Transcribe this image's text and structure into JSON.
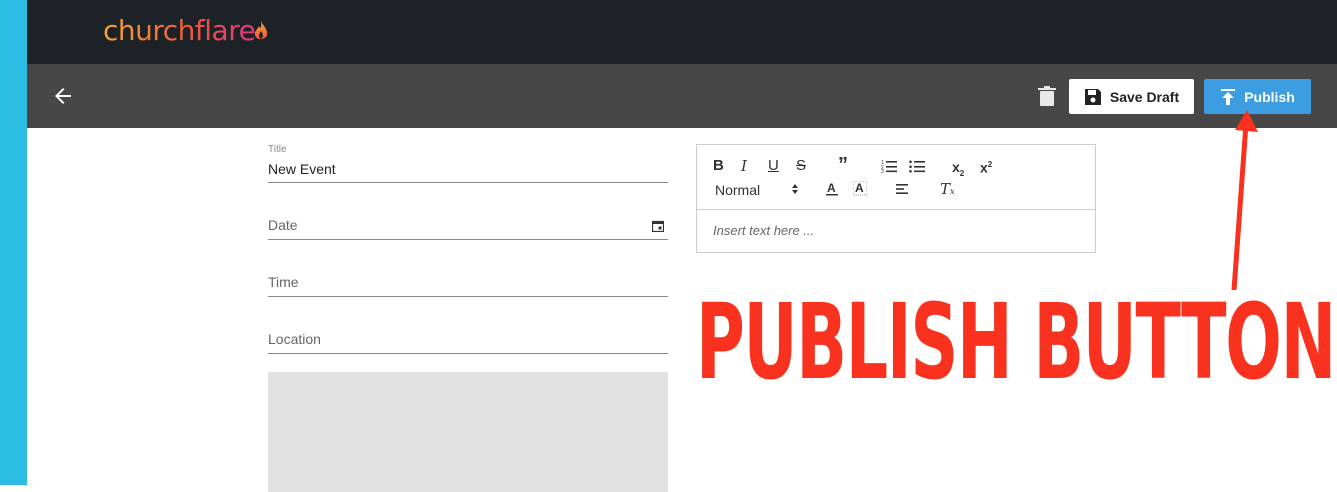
{
  "app": {
    "logo_text": "churchflare",
    "brand_gradient": [
      "#f5a13a",
      "#ee5a3c",
      "#e0387a"
    ]
  },
  "toolbar": {
    "back_icon": "arrow-left-icon",
    "delete_icon": "trash-icon",
    "save_label": "Save Draft",
    "publish_label": "Publish",
    "publish_color": "#3c9ee0"
  },
  "form": {
    "title_label": "Title",
    "title_value": "New Event",
    "date_placeholder": "Date",
    "time_placeholder": "Time",
    "location_placeholder": "Location"
  },
  "editor": {
    "header_select": "Normal",
    "placeholder": "Insert text here ...",
    "tools": [
      "bold",
      "italic",
      "underline",
      "strike",
      "blockquote",
      "ordered-list",
      "bullet-list",
      "subscript",
      "superscript",
      "font-color",
      "background-color",
      "align",
      "clear-format"
    ]
  },
  "annotation": {
    "text": "PUBLISH BUTTON",
    "color": "#f8321f"
  }
}
